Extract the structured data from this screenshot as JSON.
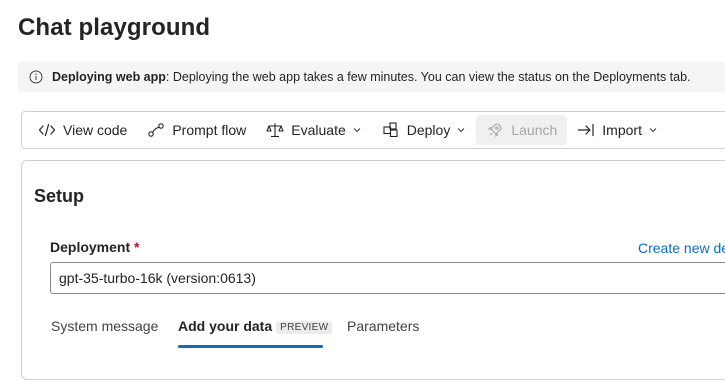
{
  "page": {
    "title": "Chat playground"
  },
  "banner": {
    "icon": "info-icon",
    "title": "Deploying web app",
    "message": ": Deploying the web app takes a few minutes. You can view the status on the Deployments tab."
  },
  "toolbar": {
    "view_code": {
      "label": "View code",
      "icon": "code-icon"
    },
    "prompt_flow": {
      "label": "Prompt flow",
      "icon": "flow-icon"
    },
    "evaluate": {
      "label": "Evaluate",
      "icon": "scale-icon"
    },
    "deploy": {
      "label": "Deploy",
      "icon": "cube-icon"
    },
    "launch": {
      "label": "Launch",
      "icon": "rocket-icon",
      "disabled": true
    },
    "import": {
      "label": "Import",
      "icon": "import-arrow-icon"
    }
  },
  "setup": {
    "title": "Setup",
    "deployment_label": "Deployment",
    "required_marker": "*",
    "create_new_link": "Create new de",
    "deployment_value": "gpt-35-turbo-16k (version:0613)"
  },
  "tabs": [
    {
      "label": "System message",
      "active": false
    },
    {
      "label": "Add your data",
      "badge": "PREVIEW",
      "active": true
    },
    {
      "label": "Parameters",
      "active": false
    }
  ],
  "colors": {
    "accent": "#0f6cbd",
    "required": "#c50f1f",
    "banner_bg": "#f5f5f5"
  }
}
